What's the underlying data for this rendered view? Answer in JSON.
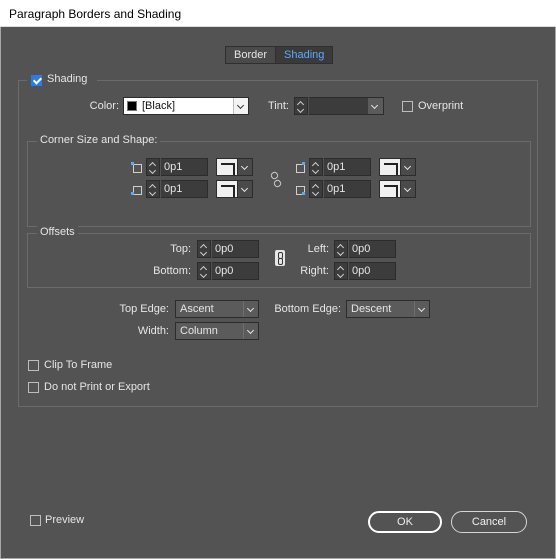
{
  "window": {
    "title": "Paragraph Borders and Shading"
  },
  "tabs": [
    {
      "label": "Border"
    },
    {
      "label": "Shading"
    }
  ],
  "shading": {
    "enabled_label": "Shading",
    "enabled": true,
    "color_label": "Color:",
    "color_value": "[Black]",
    "tint_label": "Tint:",
    "tint_value": "",
    "overprint_label": "Overprint",
    "overprint": false
  },
  "corner": {
    "legend": "Corner Size and Shape:",
    "top_left": "0p1",
    "bottom_left": "0p1",
    "top_right": "0p1",
    "bottom_right": "0p1"
  },
  "offsets": {
    "legend": "Offsets",
    "top_label": "Top:",
    "top_value": "0p0",
    "bottom_label": "Bottom:",
    "bottom_value": "0p0",
    "left_label": "Left:",
    "left_value": "0p0",
    "right_label": "Right:",
    "right_value": "0p0"
  },
  "edges": {
    "top_edge_label": "Top Edge:",
    "top_edge_value": "Ascent",
    "bottom_edge_label": "Bottom Edge:",
    "bottom_edge_value": "Descent",
    "width_label": "Width:",
    "width_value": "Column"
  },
  "options": {
    "clip_label": "Clip To Frame",
    "clip": false,
    "noprint_label": "Do not Print or Export",
    "noprint": false
  },
  "footer": {
    "preview_label": "Preview",
    "preview": false,
    "ok_label": "OK",
    "cancel_label": "Cancel"
  },
  "colors": {
    "accent": "#5ea8ff",
    "checkbox": "#2d7be5",
    "background": "#535353"
  },
  "icons": [
    "checkbox-checked-icon",
    "chevron-down-icon",
    "corner-top-left-icon",
    "corner-bottom-left-icon",
    "corner-top-right-icon",
    "corner-bottom-right-icon",
    "link-broken-icon",
    "link-icon",
    "spinner-up-down-icon"
  ]
}
